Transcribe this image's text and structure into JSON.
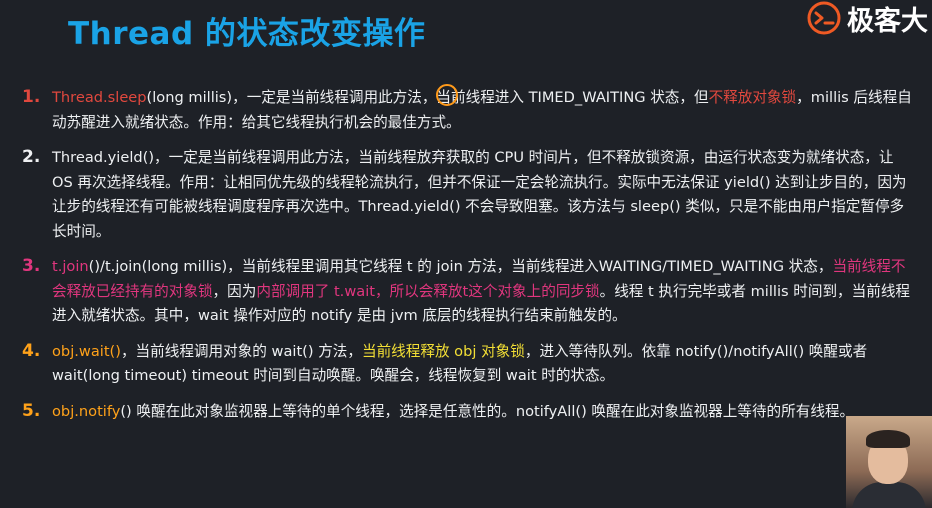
{
  "title": "Thread 的状态改变操作",
  "logo": {
    "icon": "geekbang-logo-icon",
    "text": "极客大"
  },
  "items": [
    {
      "number": "1.",
      "number_color": "#e0483e",
      "segments": [
        {
          "text": "Thread.sleep",
          "color": "#e0483e"
        },
        {
          "text": "(long millis)，一定是当前线程调用此方法，当前线程进入 TIMED_WAITING 状态，但",
          "color": "#eef0f2"
        },
        {
          "text": "不释放对象锁",
          "color": "#e0483e"
        },
        {
          "text": "，millis 后线程自动苏醒进入就绪状态。作用：给其它线程执行机会的最佳方式。",
          "color": "#eef0f2"
        }
      ]
    },
    {
      "number": "2.",
      "number_color": "#eef0f2",
      "segments": [
        {
          "text": "Thread.yield()，一定是当前线程调用此方法，当前线程放弃获取的 CPU 时间片，但不释放锁资源，由运行状态变为就绪状态，让 OS 再次选择线程。作用：让相同优先级的线程轮流执行，但并不保证一定会轮流执行。实际中无法保证 yield() 达到让步目的，因为让步的线程还有可能被线程调度程序再次选中。Thread.yield() 不会导致阻塞。该方法与 sleep() 类似，只是不能由用户指定暂停多长时间。",
          "color": "#eef0f2"
        }
      ]
    },
    {
      "number": "3.",
      "number_color": "#e0367e",
      "segments": [
        {
          "text": "t.join",
          "color": "#e0367e"
        },
        {
          "text": "()/t.join(long millis)，当前线程里调用其它线程 t 的 join 方法，当前线程进入WAITING/TIMED_WAITING 状态，",
          "color": "#eef0f2"
        },
        {
          "text": "当前线程不会释放已经持有的对象锁",
          "color": "#e0367e"
        },
        {
          "text": "，因为",
          "color": "#eef0f2"
        },
        {
          "text": "内部调用了 t.wait，所以会释放t这个对象上的同步锁",
          "color": "#e0367e"
        },
        {
          "text": "。线程 t 执行完毕或者 millis 时间到，当前线程进入就绪状态。其中，wait 操作对应的 notify 是由 jvm 底层的线程执行结束前触发的。",
          "color": "#eef0f2"
        }
      ]
    },
    {
      "number": "4.",
      "number_color": "#ffa21a",
      "segments": [
        {
          "text": "obj.wait()",
          "color": "#ffa21a"
        },
        {
          "text": "，当前线程调用对象的 wait() 方法，",
          "color": "#eef0f2"
        },
        {
          "text": "当前线程释放 obj 对象锁",
          "color": "#f3df35"
        },
        {
          "text": "，进入等待队列。依靠 notify()/notifyAll() 唤醒或者 wait(long timeout) timeout 时间到自动唤醒。唤醒会，线程恢复到 wait 时的状态。",
          "color": "#eef0f2"
        }
      ]
    },
    {
      "number": "5.",
      "number_color": "#ffa21a",
      "segments": [
        {
          "text": "obj.notify",
          "color": "#ffa21a"
        },
        {
          "text": "() 唤醒在此对象监视器上等待的单个线程，选择是任意性的。notifyAll() 唤醒在此对象监视器上等待的所有线程。",
          "color": "#eef0f2"
        }
      ]
    }
  ]
}
